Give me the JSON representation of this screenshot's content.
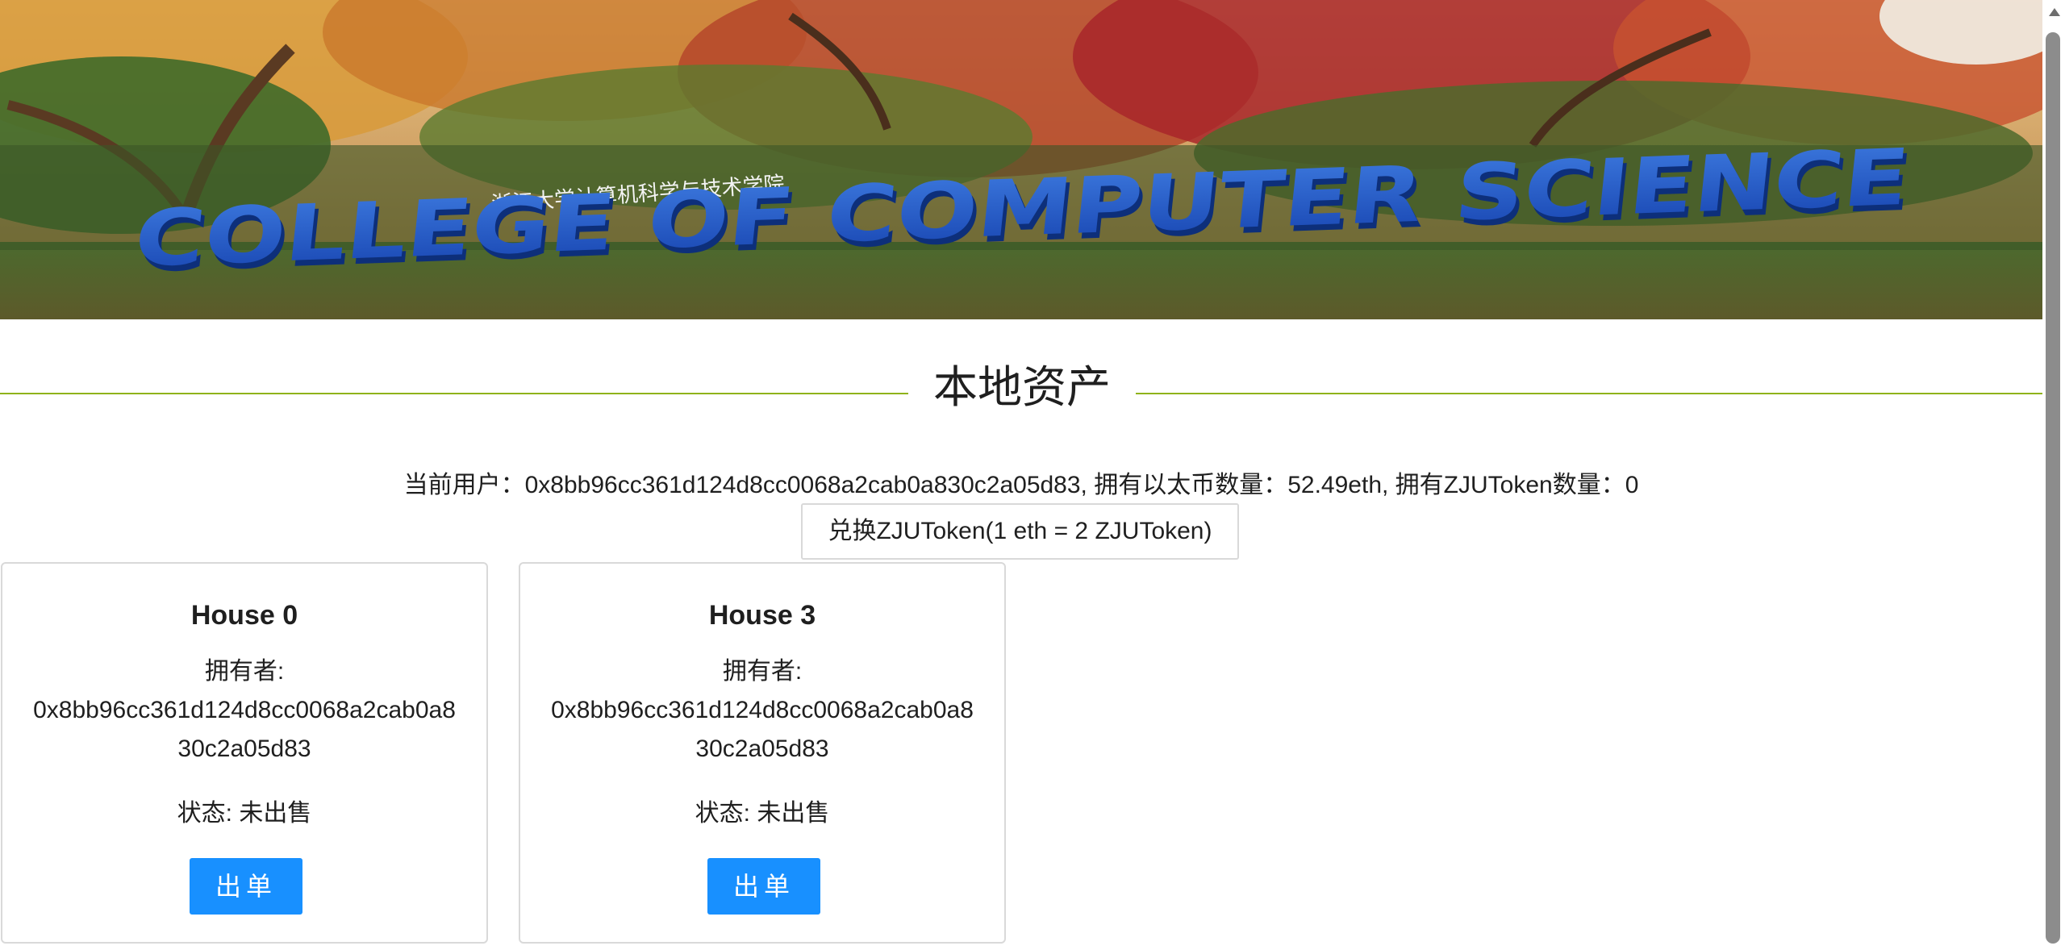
{
  "banner": {
    "caption_cn": "浙江大学计算机科学与技术学院",
    "caption_en": "COLLEGE OF COMPUTER SCIENCE"
  },
  "section": {
    "title": "本地资产"
  },
  "user": {
    "info_text": "当前用户：0x8bb96cc361d124d8cc0068a2cab0a830c2a05d83, 拥有以太币数量：52.49eth, 拥有ZJUToken数量：0",
    "exchange_button_label": "兑换ZJUToken(1 eth = 2 ZJUToken)"
  },
  "houses": [
    {
      "title": "House 0",
      "owner_label": "拥有者:",
      "owner_address": "0x8bb96cc361d124d8cc0068a2cab0a830c2a05d83",
      "status": "状态: 未出售",
      "button_label": "出单"
    },
    {
      "title": "House 3",
      "owner_label": "拥有者:",
      "owner_address": "0x8bb96cc361d124d8cc0068a2cab0a830c2a05d83",
      "status": "状态: 未出售",
      "button_label": "出单"
    }
  ],
  "colors": {
    "primary_button": "#1890ff",
    "divider": "#8fb31a",
    "card_border": "#d9d9d9"
  }
}
